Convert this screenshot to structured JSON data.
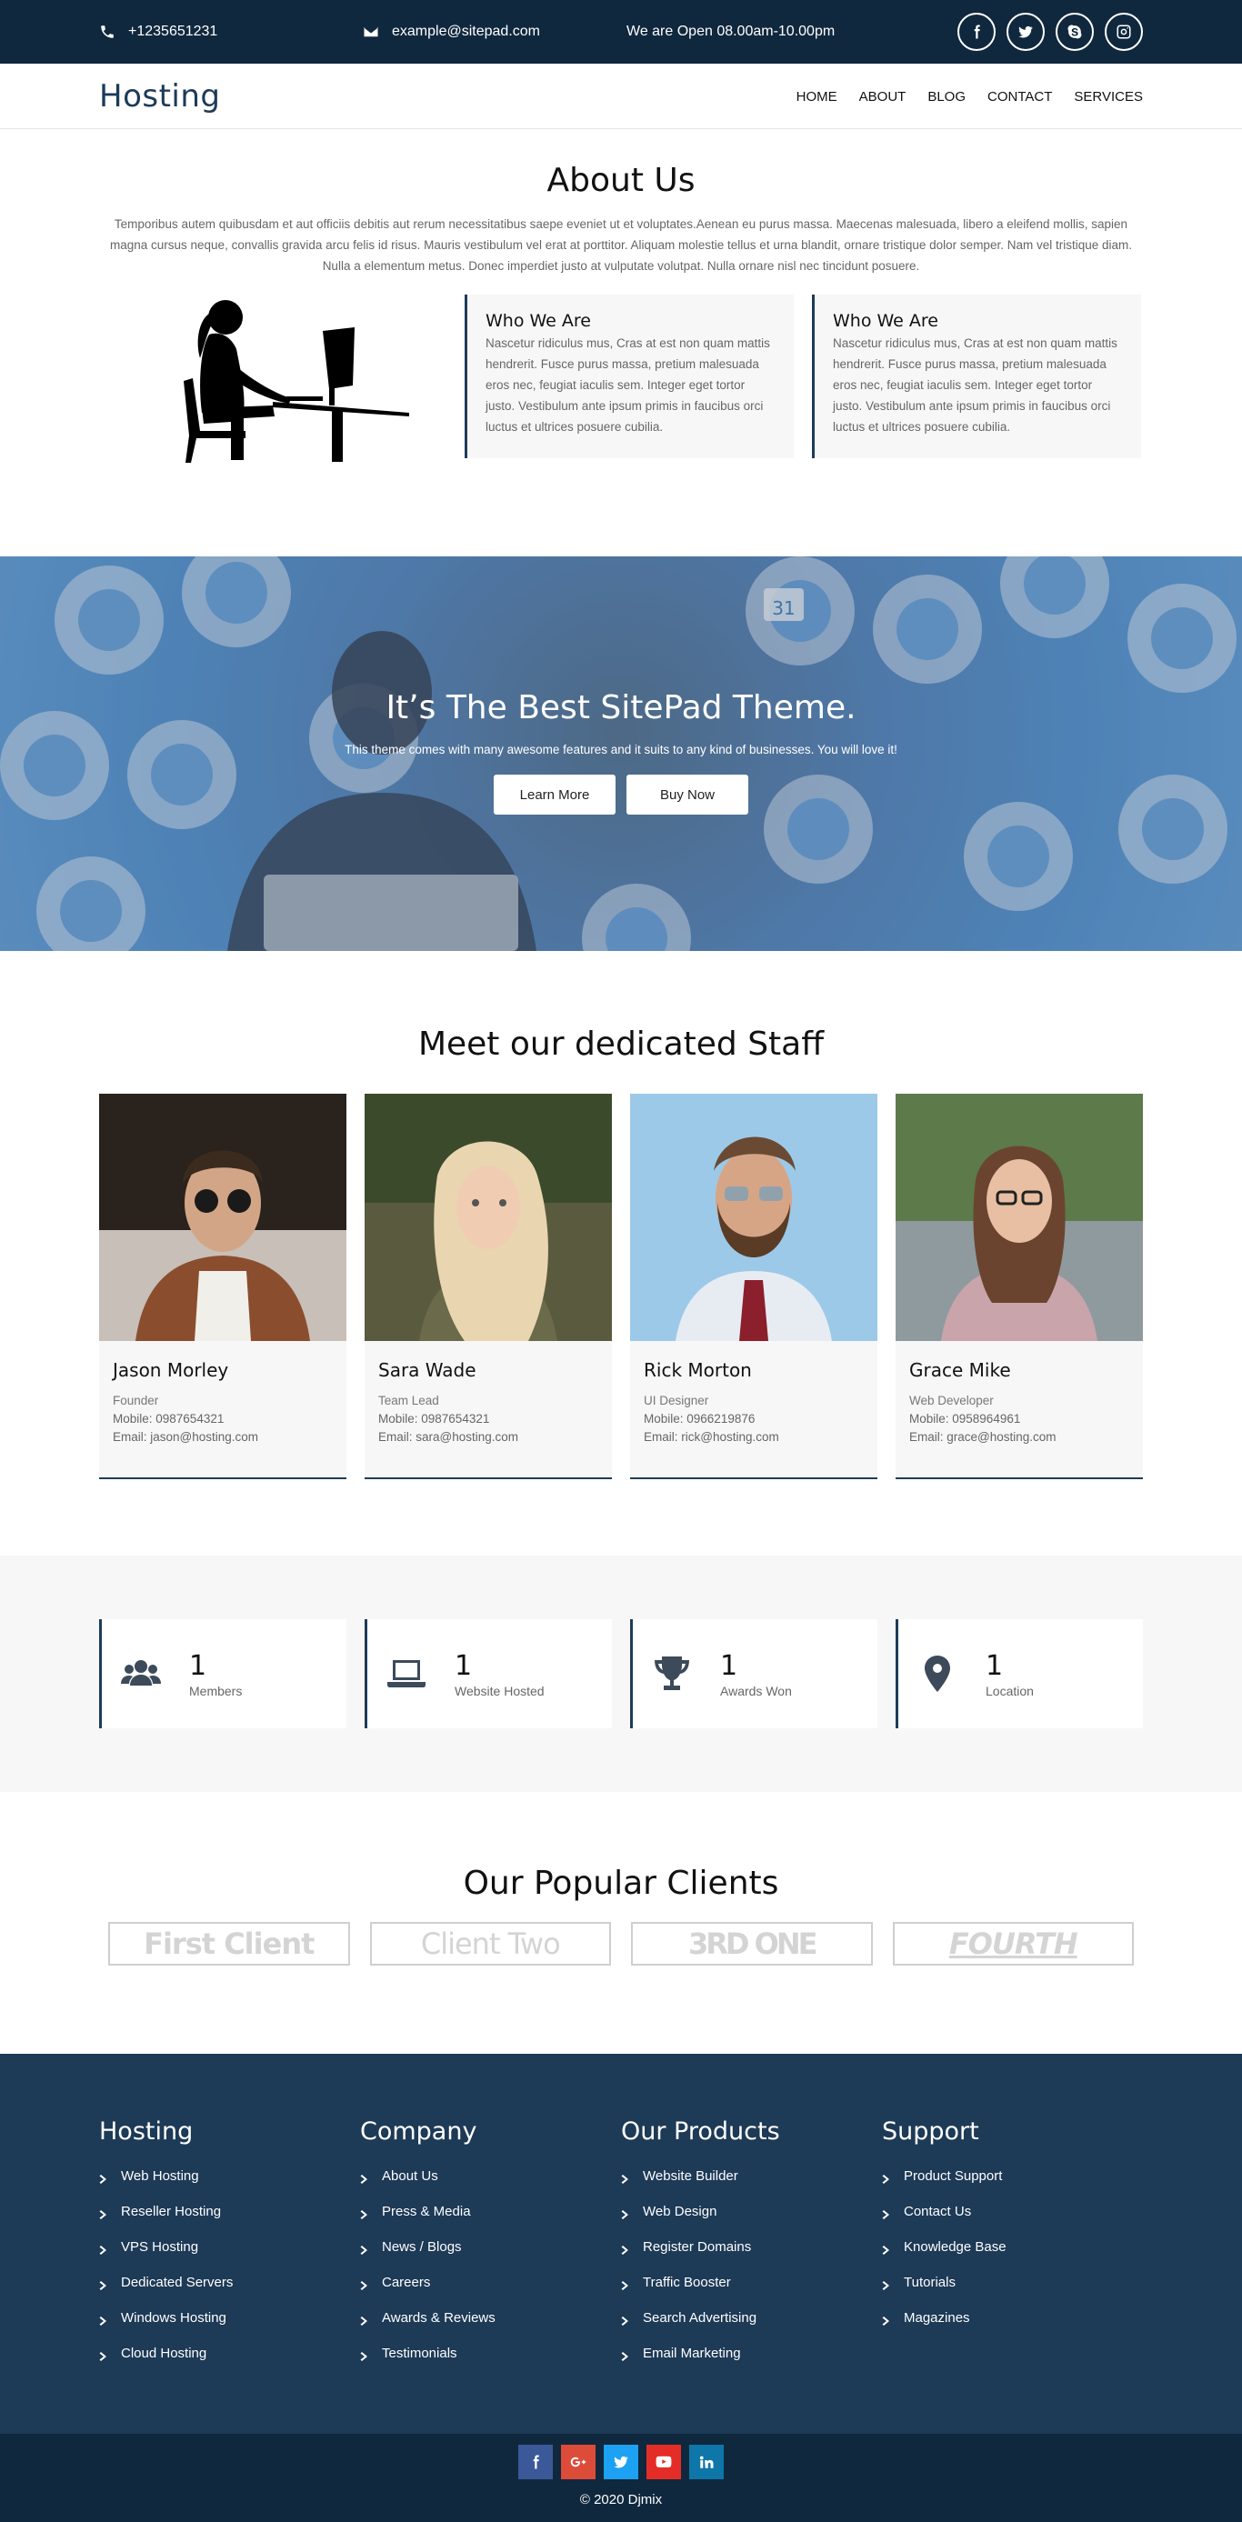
{
  "topbar": {
    "phone": "+1235651231",
    "email": "example@sitepad.com",
    "hours": "We are Open 08.00am-10.00pm",
    "socials": [
      "facebook-icon",
      "twitter-icon",
      "skype-icon",
      "instagram-icon"
    ]
  },
  "nav": {
    "logo": "Hosting",
    "items": [
      "HOME",
      "ABOUT",
      "BLOG",
      "CONTACT",
      "SERVICES"
    ]
  },
  "about": {
    "title": "About Us",
    "text": "Temporibus autem quibusdam et aut officiis debitis aut rerum necessitatibus saepe eveniet ut et voluptates.Aenean eu purus massa. Maecenas malesuada, libero a eleifend mollis, sapien magna cursus neque, convallis gravida arcu felis id risus. Mauris vestibulum vel erat at porttitor. Aliquam molestie tellus et urna blandit, ornare tristique dolor semper. Nam vel tristique diam. Nulla a elementum metus. Donec imperdiet justo at vulputate volutpat. Nulla ornare nisl nec tincidunt posuere.",
    "cards": [
      {
        "title": "Who We Are",
        "text": "Nascetur ridiculus mus, Cras at est non quam mattis hendrerit. Fusce purus massa, pretium malesuada eros nec, feugiat iaculis sem. Integer eget tortor justo. Vestibulum ante ipsum primis in faucibus orci luctus et ultrices posuere cubilia."
      },
      {
        "title": "Who We Are",
        "text": "Nascetur ridiculus mus, Cras at est non quam mattis hendrerit. Fusce purus massa, pretium malesuada eros nec, feugiat iaculis sem. Integer eget tortor justo. Vestibulum ante ipsum primis in faucibus orci luctus et ultrices posuere cubilia."
      }
    ]
  },
  "hero": {
    "title": "It’s The Best SitePad Theme.",
    "subtitle": "This theme comes with many awesome features and it suits to any kind of businesses. You will love it!",
    "learn_more": "Learn More",
    "buy_now": "Buy Now",
    "calendar_number": "31"
  },
  "staff": {
    "title": "Meet our dedicated Staff",
    "members": [
      {
        "name": "Jason Morley",
        "role": "Founder",
        "mobile": "Mobile: 0987654321",
        "email": "Email: jason@hosting.com"
      },
      {
        "name": "Sara Wade",
        "role": "Team Lead",
        "mobile": "Mobile: 0987654321",
        "email": "Email: sara@hosting.com"
      },
      {
        "name": "Rick Morton",
        "role": "UI Designer",
        "mobile": "Mobile: 0966219876",
        "email": "Email: rick@hosting.com"
      },
      {
        "name": "Grace Mike",
        "role": "Web Developer",
        "mobile": "Mobile: 0958964961",
        "email": "Email: grace@hosting.com"
      }
    ]
  },
  "stats": [
    {
      "icon": "users-icon",
      "number": "1",
      "label": "Members"
    },
    {
      "icon": "laptop-icon",
      "number": "1",
      "label": "Website Hosted"
    },
    {
      "icon": "trophy-icon",
      "number": "1",
      "label": "Awards Won"
    },
    {
      "icon": "map-pin-icon",
      "number": "1",
      "label": "Location"
    }
  ],
  "clients": {
    "title": "Our Popular Clients",
    "logos": [
      "First Client",
      "Client Two",
      "3RD ONE",
      "FOURTH"
    ]
  },
  "footer": {
    "columns": [
      {
        "title": "Hosting",
        "links": [
          "Web Hosting",
          "Reseller Hosting",
          "VPS Hosting",
          "Dedicated Servers",
          "Windows Hosting",
          "Cloud Hosting"
        ]
      },
      {
        "title": "Company",
        "links": [
          "About Us",
          "Press & Media",
          "News / Blogs",
          "Careers",
          "Awards & Reviews",
          "Testimonials"
        ]
      },
      {
        "title": "Our Products",
        "links": [
          "Website Builder",
          "Web Design",
          "Register Domains",
          "Traffic Booster",
          "Search Advertising",
          "Email Marketing"
        ]
      },
      {
        "title": "Support",
        "links": [
          "Product Support",
          "Contact Us",
          "Knowledge Base",
          "Tutorials",
          "Magazines"
        ]
      }
    ],
    "social_colors": {
      "facebook": "#3b5998",
      "google": "#dd4b39",
      "twitter": "#1da1f2",
      "youtube": "#e52d27",
      "linkedin": "#0e76a8"
    },
    "copyright": "© 2020 Djmix"
  },
  "colors": {
    "dark": "#10283e",
    "navy": "#1d3a56",
    "accent": "#1e3c5a"
  }
}
